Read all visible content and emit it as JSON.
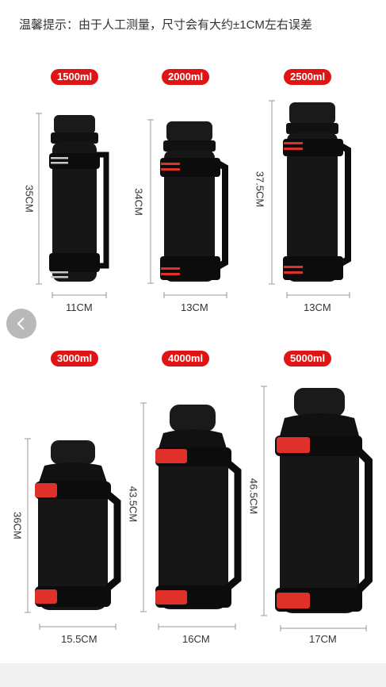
{
  "notice": "温馨提示：由于人工测量，尺寸会有大约±1CM左右误差",
  "products": [
    {
      "capacity": "1500ml",
      "height": "35CM",
      "width": "11CM",
      "accent": "#bfbfbf"
    },
    {
      "capacity": "2000ml",
      "height": "34CM",
      "width": "13CM",
      "accent": "#e0302a"
    },
    {
      "capacity": "2500ml",
      "height": "37.5CM",
      "width": "13CM",
      "accent": "#e0302a"
    },
    {
      "capacity": "3000ml",
      "height": "36CM",
      "width": "15.5CM",
      "accent": "#e0302a"
    },
    {
      "capacity": "4000ml",
      "height": "43.5CM",
      "width": "16CM",
      "accent": "#e0302a"
    },
    {
      "capacity": "5000ml",
      "height": "46.5CM",
      "width": "17CM",
      "accent": "#e0302a"
    }
  ],
  "colors": {
    "badge": "#e01414",
    "bottle": "#161616",
    "accent_red": "#e0302a",
    "accent_silver": "#bfbfbf"
  },
  "icons": {
    "back": "chevron-left-icon"
  }
}
